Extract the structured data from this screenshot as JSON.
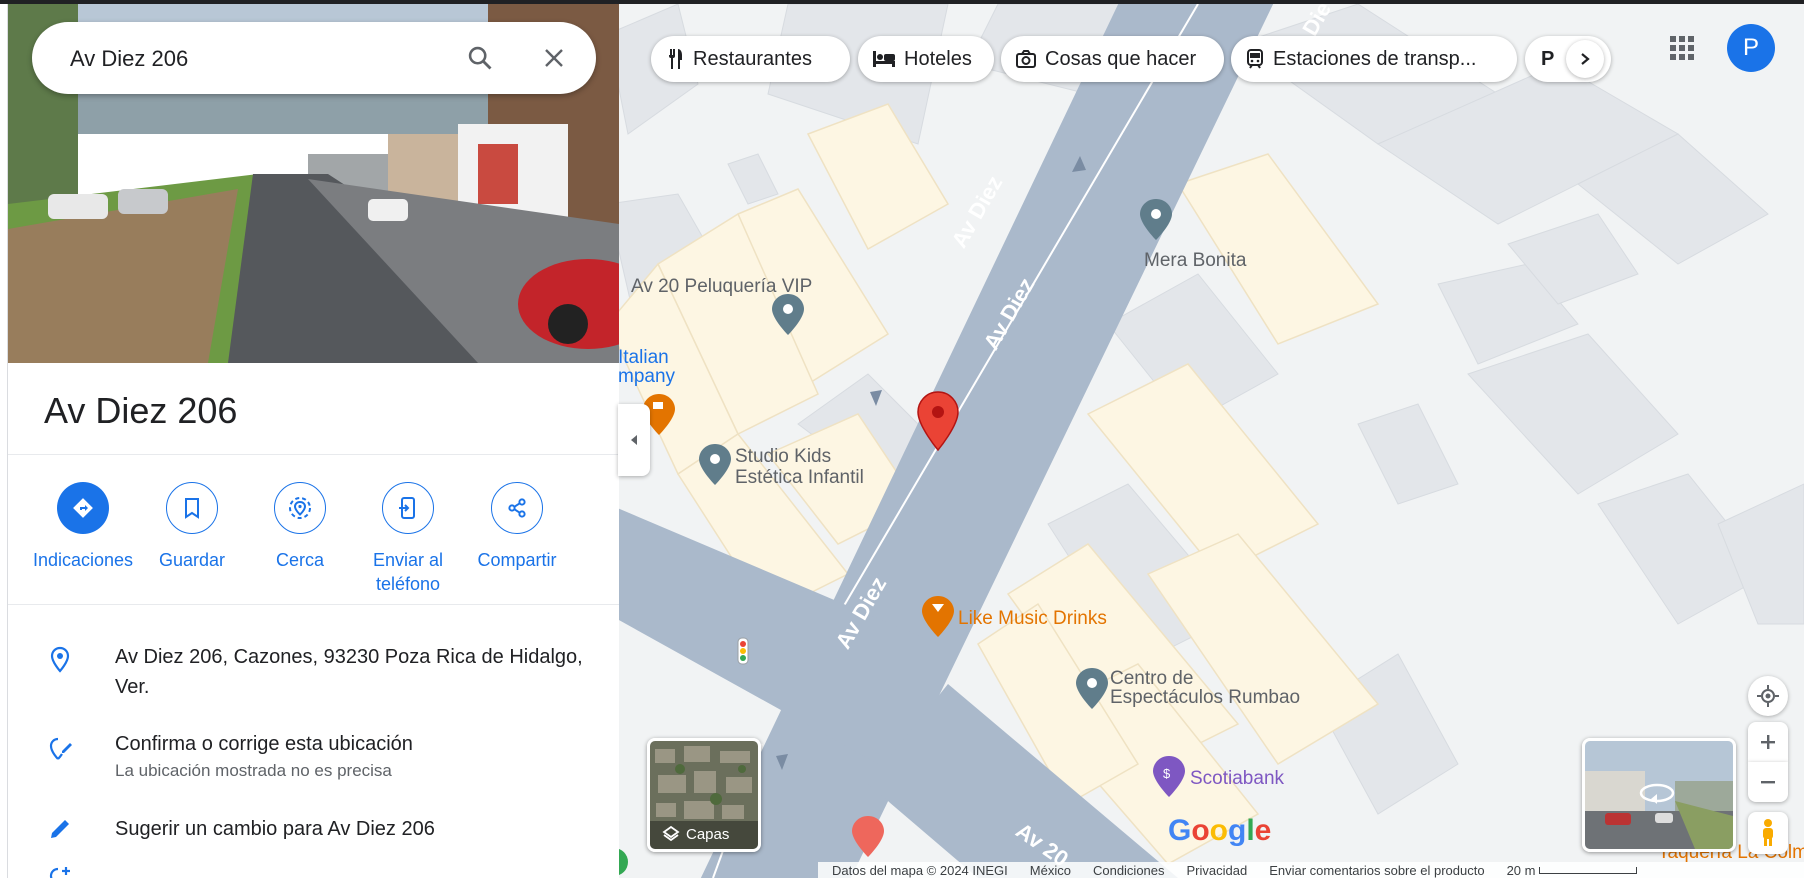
{
  "search": {
    "value": "Av Diez 206"
  },
  "place": {
    "title": "Av Diez 206"
  },
  "actions": [
    {
      "label": "Indicaciones"
    },
    {
      "label": "Guardar"
    },
    {
      "label": "Cerca"
    },
    {
      "label": "Enviar al teléfono"
    },
    {
      "label": "Compartir"
    }
  ],
  "info": {
    "address": "Av Diez 206, Cazones, 93230 Poza Rica de Hidalgo, Ver.",
    "confirm_title": "Confirma o corrige esta ubicación",
    "confirm_sub": "La ubicación mostrada no es precisa",
    "suggest": "Sugerir un cambio para Av Diez 206"
  },
  "chips": [
    {
      "label": "Restaurantes",
      "icon": "fork-knife-icon"
    },
    {
      "label": "Hoteles",
      "icon": "bed-icon"
    },
    {
      "label": "Cosas que hacer",
      "icon": "camera-icon"
    },
    {
      "label": "Estaciones de transp...",
      "icon": "train-icon"
    },
    {
      "label": "P",
      "icon": ""
    }
  ],
  "account": {
    "initial": "P"
  },
  "map_labels": {
    "peluqueria": "Av 20 Peluquería VIP",
    "mera": "Mera Bonita",
    "italian1": "Italian",
    "italian2": "mpany",
    "studio1": "Studio Kids",
    "studio2": "Estética Infantil",
    "like": "Like Music Drinks",
    "centro1": "Centro de",
    "centro2": "Espectáculos Rumbao",
    "scotia": "Scotiabank",
    "taqueria": "Taquería La Colm",
    "street": "Av Diez",
    "street_partial": "Av 20",
    "street_top": "Die"
  },
  "layers": {
    "label": "Capas"
  },
  "footer": {
    "data": "Datos del mapa © 2024 INEGI",
    "country": "México",
    "terms": "Condiciones",
    "privacy": "Privacidad",
    "feedback": "Enviar comentarios sobre el producto",
    "scale": "20 m"
  },
  "logo": {
    "text": "Google"
  },
  "colors": {
    "accent": "#1a73e8",
    "pin": "#ea4335",
    "poi_orange": "#e37400",
    "poi_gray": "#607d8b",
    "road": "#aab9cb"
  }
}
